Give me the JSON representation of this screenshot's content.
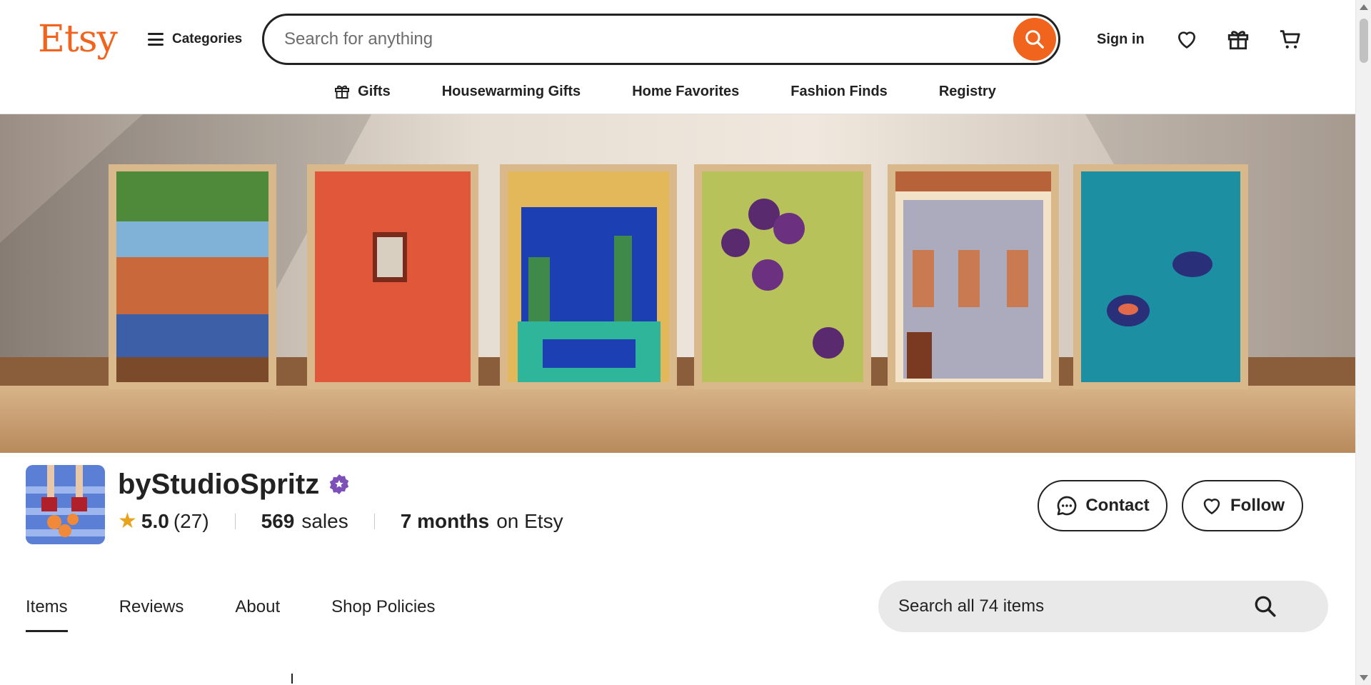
{
  "header": {
    "logo": "Etsy",
    "categories_label": "Categories",
    "search_placeholder": "Search for anything",
    "sign_in_label": "Sign in",
    "icons": [
      "search-icon",
      "heart-icon",
      "gift-icon",
      "cart-icon"
    ]
  },
  "subnav": {
    "items": [
      {
        "label": "Gifts",
        "icon": "gift-icon"
      },
      {
        "label": "Housewarming Gifts"
      },
      {
        "label": "Home Favorites"
      },
      {
        "label": "Fashion Finds"
      },
      {
        "label": "Registry"
      }
    ]
  },
  "shop": {
    "name": "byStudioSpritz",
    "rating": "5.0",
    "review_count": "(27)",
    "sales_count": "569",
    "sales_label": "sales",
    "tenure_value": "7 months",
    "tenure_label": "on Etsy",
    "contact_label": "Contact",
    "follow_label": "Follow"
  },
  "tabs": [
    {
      "label": "Items",
      "active": true
    },
    {
      "label": "Reviews",
      "active": false
    },
    {
      "label": "About",
      "active": false
    },
    {
      "label": "Shop Policies",
      "active": false
    }
  ],
  "shop_search": {
    "placeholder": "Search all 74 items"
  },
  "colors": {
    "brand": "#f1641e",
    "text": "#222222",
    "star": "#e8a21e",
    "star_seller_badge": "#7d4fb9"
  }
}
